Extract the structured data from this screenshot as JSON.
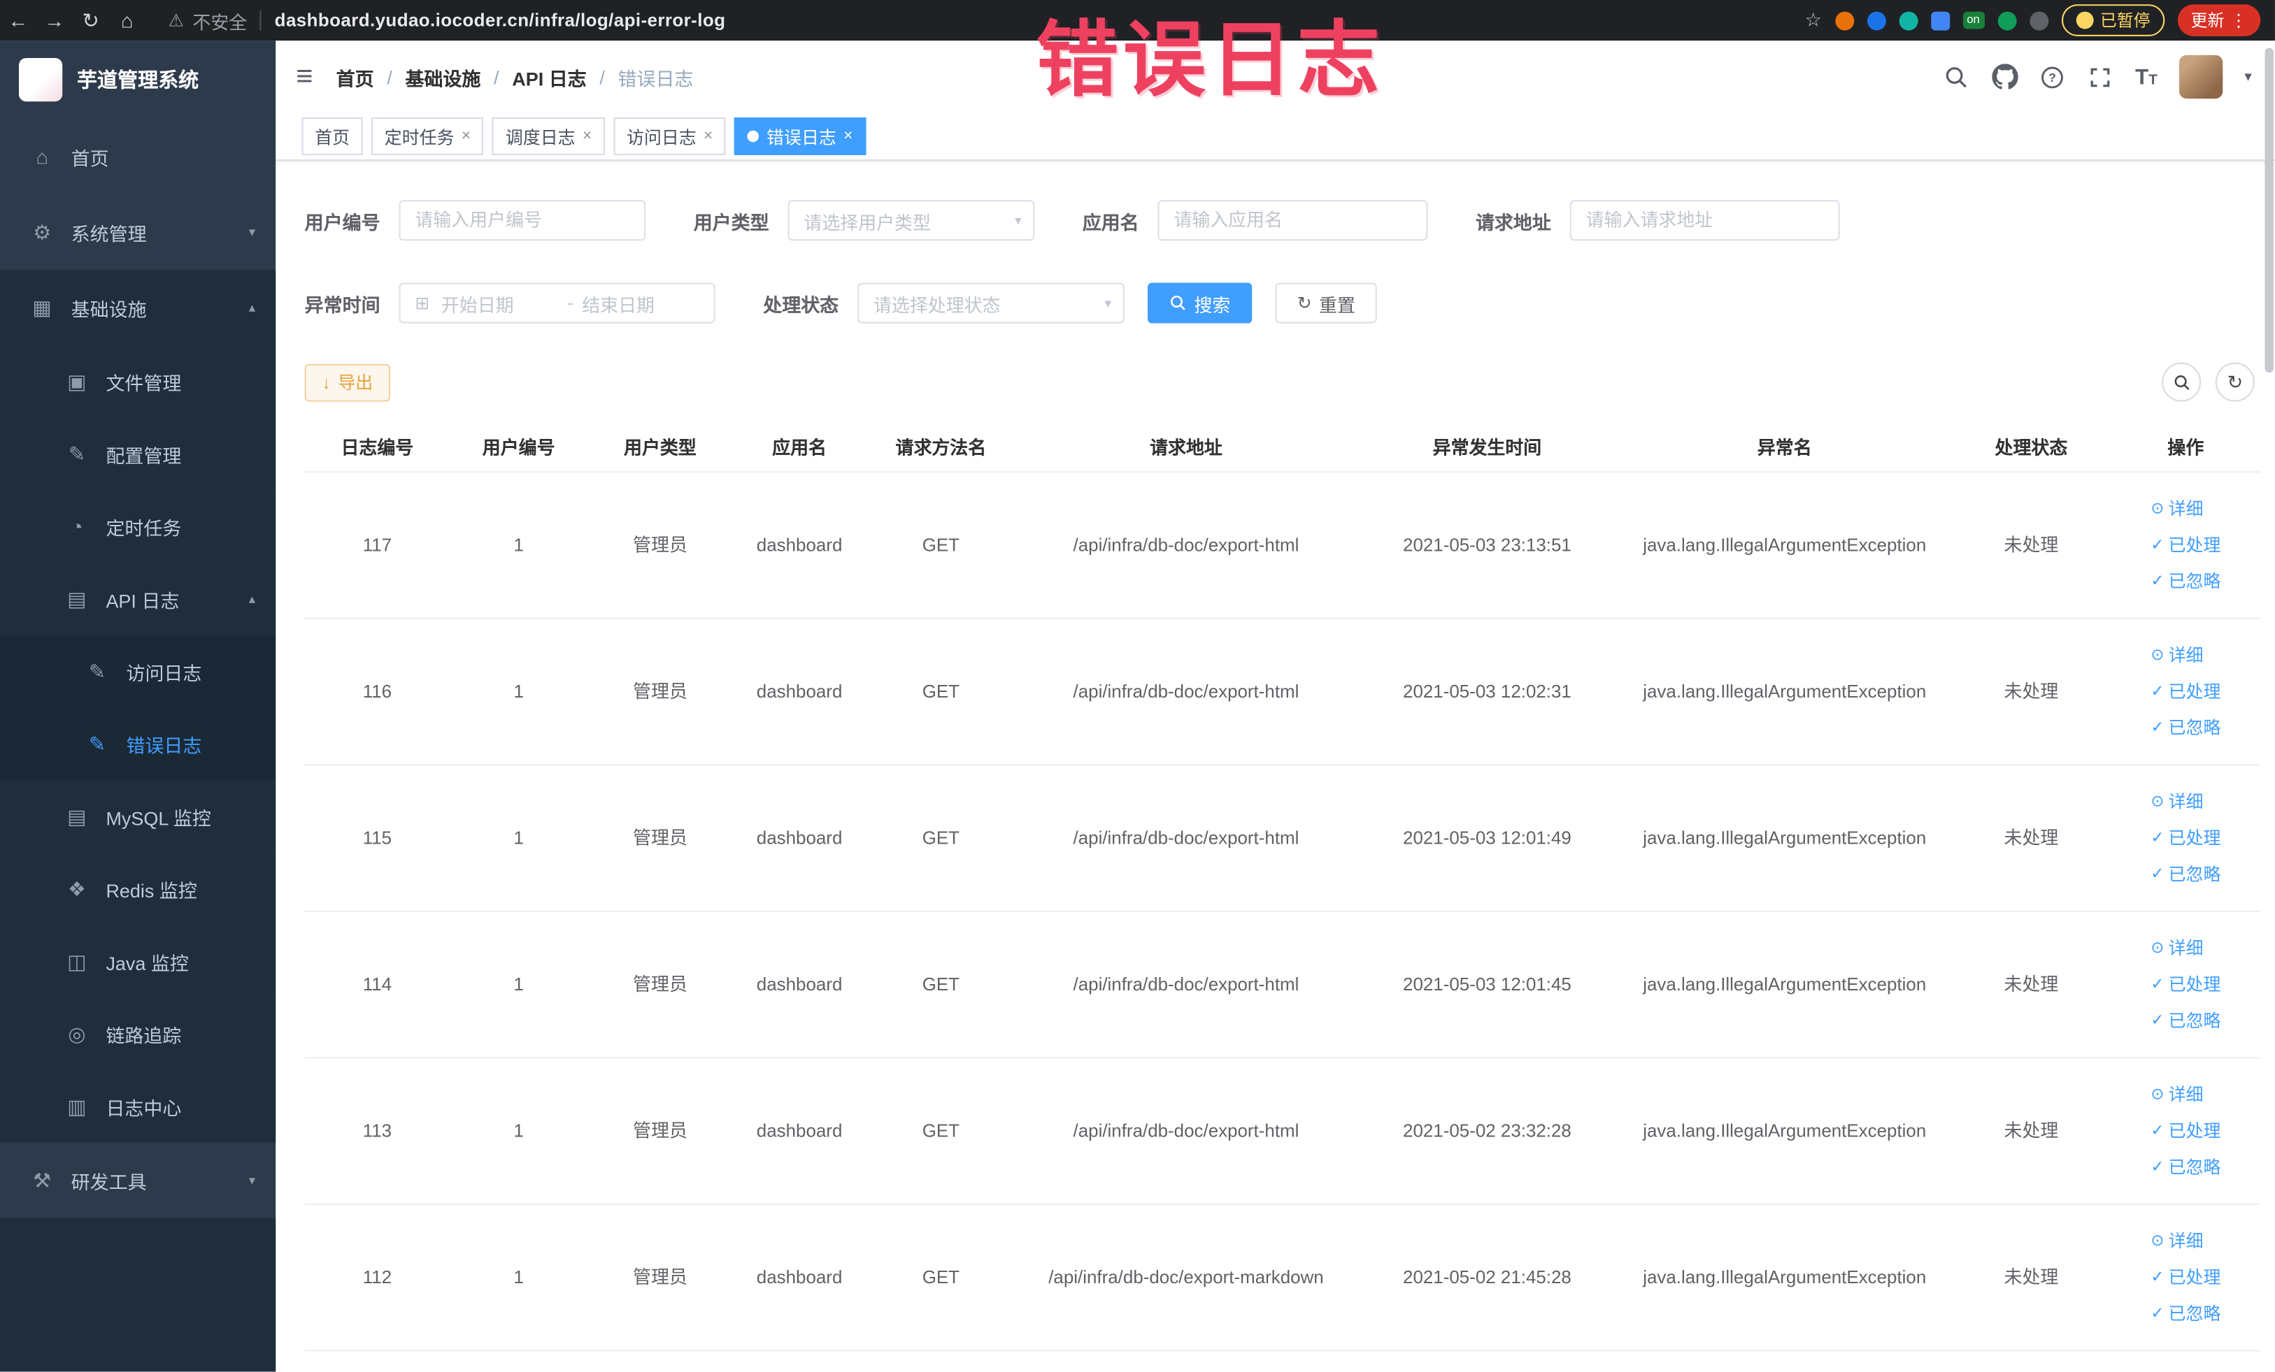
{
  "colors": {
    "primary": "#409EFF",
    "warning_text": "#E6A23C",
    "warning_bg": "#FDF6EC",
    "warning_border": "#F3D19E",
    "sidebar_bg": "#2D3A4B",
    "sidebar_submenu_bg": "#1F2D3D",
    "chrome_bg": "#1F2125",
    "update_button_bg": "#D93025",
    "annotation_red": "#EE4160",
    "active_tab_bg": "#409EFF"
  },
  "icons": {
    "back": "←",
    "forward": "→",
    "reload": "↻",
    "home": "⌂",
    "warning": "⚠",
    "star": "☆",
    "more": "⋮",
    "hamburger": "≡",
    "caret_down": "▾",
    "chevron_down": "▾",
    "chevron_up": "▴",
    "calendar": "⊞",
    "download": "↓",
    "refresh": "↻",
    "eye": "⊙",
    "check": "✓",
    "close": "×",
    "menu_home": "⌂",
    "menu_system": "⚙",
    "menu_infra": "▦",
    "menu_file": "▣",
    "menu_config": "✎",
    "menu_timer": "◔",
    "menu_apilog": "▤",
    "menu_doc": "✎",
    "menu_mysql": "▤",
    "menu_redis": "❖",
    "menu_java": "◫",
    "menu_trace": "◎",
    "menu_logcenter": "▥",
    "menu_tools": "⚒"
  },
  "browser": {
    "security_label": "不安全",
    "url": "dashboard.yudao.iocoder.cn/infra/log/api-error-log",
    "ext_on_label": "on",
    "paused_badge": "已暂停",
    "update_button": "更新"
  },
  "sidebar": {
    "title": "芋道管理系统",
    "items": [
      {
        "label": "首页"
      },
      {
        "label": "系统管理"
      },
      {
        "label": "基础设施"
      },
      {
        "label": "文件管理"
      },
      {
        "label": "配置管理"
      },
      {
        "label": "定时任务"
      },
      {
        "label": "API 日志"
      },
      {
        "label": "访问日志"
      },
      {
        "label": "错误日志",
        "active": true
      },
      {
        "label": "MySQL 监控"
      },
      {
        "label": "Redis 监控"
      },
      {
        "label": "Java 监控"
      },
      {
        "label": "链路追踪"
      },
      {
        "label": "日志中心"
      },
      {
        "label": "研发工具"
      }
    ]
  },
  "breadcrumb": {
    "items": [
      "首页",
      "基础设施",
      "API 日志",
      "错误日志"
    ],
    "separator": "/"
  },
  "tabs": [
    {
      "label": "首页",
      "closable": false,
      "active": false
    },
    {
      "label": "定时任务",
      "closable": true,
      "active": false
    },
    {
      "label": "调度日志",
      "closable": true,
      "active": false
    },
    {
      "label": "访问日志",
      "closable": true,
      "active": false
    },
    {
      "label": "错误日志",
      "closable": true,
      "active": true
    }
  ],
  "filters": {
    "user_id": {
      "label": "用户编号",
      "placeholder": "请输入用户编号",
      "value": ""
    },
    "user_type": {
      "label": "用户类型",
      "placeholder": "请选择用户类型",
      "value": ""
    },
    "app_name": {
      "label": "应用名",
      "placeholder": "请输入应用名",
      "value": ""
    },
    "request_url": {
      "label": "请求地址",
      "placeholder": "请输入请求地址",
      "value": ""
    },
    "exception_time": {
      "label": "异常时间",
      "start_placeholder": "开始日期",
      "separator": "-",
      "end_placeholder": "结束日期"
    },
    "process_status": {
      "label": "处理状态",
      "placeholder": "请选择处理状态",
      "value": ""
    },
    "search_button": "搜索",
    "reset_button": "重置"
  },
  "toolbar": {
    "export_button": "导出"
  },
  "table": {
    "columns": [
      "日志编号",
      "用户编号",
      "用户类型",
      "应用名",
      "请求方法名",
      "请求地址",
      "异常发生时间",
      "异常名",
      "处理状态",
      "操作"
    ],
    "actions": {
      "detail": "详细",
      "processed": "已处理",
      "ignored": "已忽略"
    },
    "rows": [
      {
        "log_id": "117",
        "user_id": "1",
        "user_type": "管理员",
        "app_name": "dashboard",
        "method": "GET",
        "url": "/api/infra/db-doc/export-html",
        "time": "2021-05-03 23:13:51",
        "exception": "java.lang.IllegalArgumentException",
        "status": "未处理"
      },
      {
        "log_id": "116",
        "user_id": "1",
        "user_type": "管理员",
        "app_name": "dashboard",
        "method": "GET",
        "url": "/api/infra/db-doc/export-html",
        "time": "2021-05-03 12:02:31",
        "exception": "java.lang.IllegalArgumentException",
        "status": "未处理"
      },
      {
        "log_id": "115",
        "user_id": "1",
        "user_type": "管理员",
        "app_name": "dashboard",
        "method": "GET",
        "url": "/api/infra/db-doc/export-html",
        "time": "2021-05-03 12:01:49",
        "exception": "java.lang.IllegalArgumentException",
        "status": "未处理"
      },
      {
        "log_id": "114",
        "user_id": "1",
        "user_type": "管理员",
        "app_name": "dashboard",
        "method": "GET",
        "url": "/api/infra/db-doc/export-html",
        "time": "2021-05-03 12:01:45",
        "exception": "java.lang.IllegalArgumentException",
        "status": "未处理"
      },
      {
        "log_id": "113",
        "user_id": "1",
        "user_type": "管理员",
        "app_name": "dashboard",
        "method": "GET",
        "url": "/api/infra/db-doc/export-html",
        "time": "2021-05-02 23:32:28",
        "exception": "java.lang.IllegalArgumentException",
        "status": "未处理"
      },
      {
        "log_id": "112",
        "user_id": "1",
        "user_type": "管理员",
        "app_name": "dashboard",
        "method": "GET",
        "url": "/api/infra/db-doc/export-markdown",
        "time": "2021-05-02 21:45:28",
        "exception": "java.lang.IllegalArgumentException",
        "status": "未处理"
      }
    ]
  },
  "annotation": {
    "text": "错误日志"
  }
}
